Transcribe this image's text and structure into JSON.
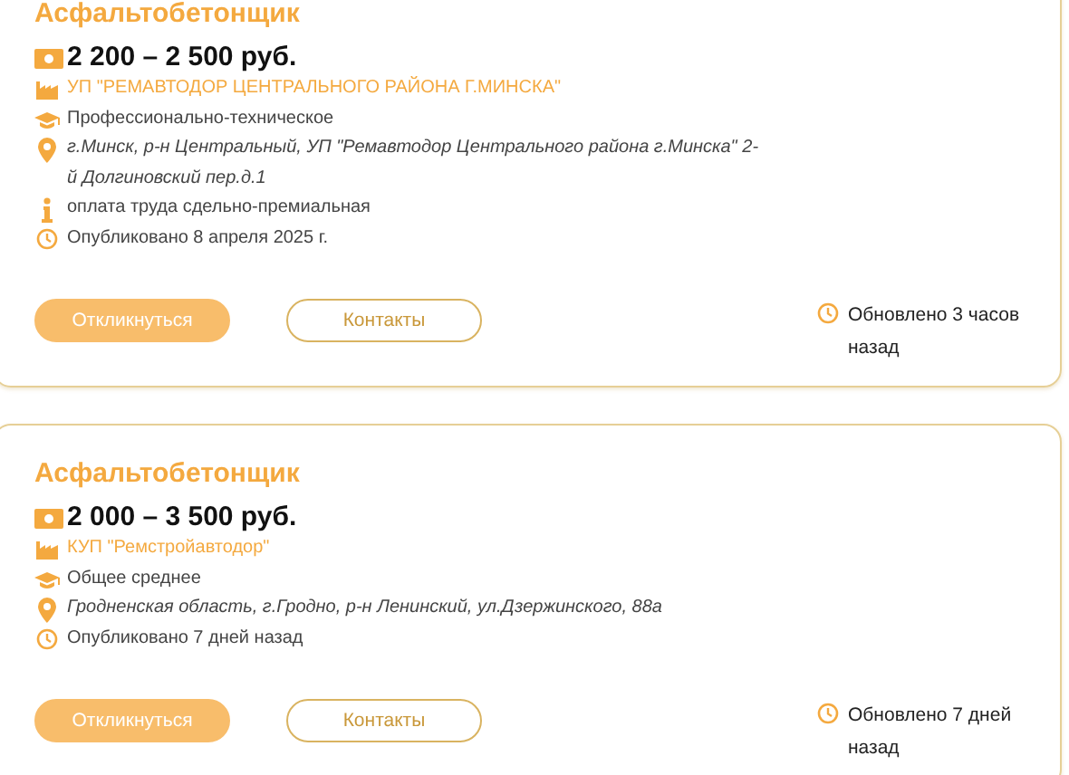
{
  "vacancies": [
    {
      "title": "Асфальтобетонщик",
      "salary": "2 200 – 2 500 руб.",
      "details": [
        {
          "kind": "employer",
          "text": "УП \"РЕМАВТОДОР ЦЕНТРАЛЬНОГО РАЙОНА Г.МИНСКА\""
        },
        {
          "kind": "education",
          "text": "Профессионально-техническое"
        },
        {
          "kind": "address",
          "text": "г.Минск, р-н Центральный, УП \"Ремавтодор Центрального района г.Минска\" 2-й Долгиновский пер.д.1"
        },
        {
          "kind": "info",
          "text": "оплата труда сдельно-премиальная"
        },
        {
          "kind": "published",
          "text": "Опубликовано 8 апреля 2025 г."
        }
      ],
      "respond_button": "Откликнуться",
      "contacts_button": "Контакты",
      "updated": "Обновлено 3 часов назад"
    },
    {
      "title": "Асфальтобетонщик",
      "salary": "2 000 – 3 500 руб.",
      "details": [
        {
          "kind": "employer",
          "text": "КУП \"Ремстройавтодор\""
        },
        {
          "kind": "education",
          "text": "Общее среднее"
        },
        {
          "kind": "address",
          "text": "Гродненская область, г.Гродно, р-н Ленинский, ул.Дзержинского, 88а"
        },
        {
          "kind": "published",
          "text": "Опубликовано 7 дней назад"
        }
      ],
      "respond_button": "Откликнуться",
      "contacts_button": "Контакты",
      "updated": "Обновлено 7 дней назад"
    }
  ]
}
